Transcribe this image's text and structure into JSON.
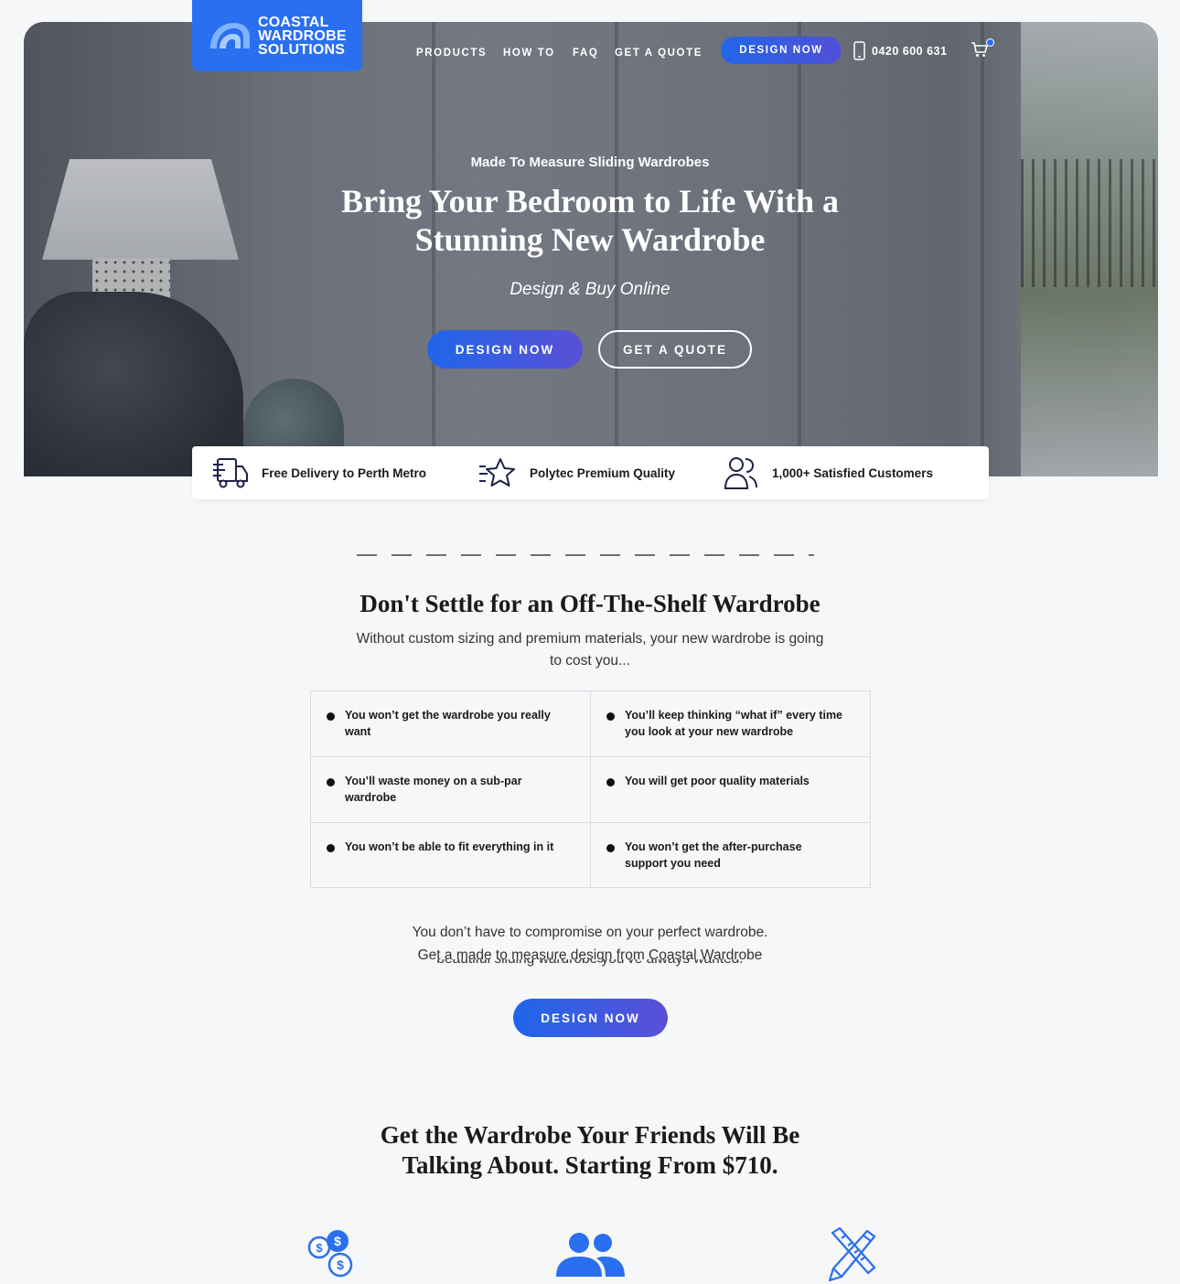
{
  "brand": {
    "line1": "COASTAL",
    "line2": "WARDROBE",
    "line3": "SOLUTIONS",
    "color": "#2a6ff0"
  },
  "nav": {
    "links": [
      "PRODUCTS",
      "HOW TO",
      "FAQ",
      "GET A QUOTE"
    ],
    "design_button": "DESIGN NOW",
    "phone": "0420 600 631",
    "cart_icon": "cart-icon",
    "phone_icon": "phone-icon"
  },
  "hero": {
    "eyebrow": "Made To Measure Sliding Wardrobes",
    "title": "Bring Your Bedroom to Life With a Stunning New Wardrobe",
    "subtitle": "Design & Buy Online",
    "primary_button": "DESIGN NOW",
    "secondary_button": "GET A QUOTE"
  },
  "features": [
    {
      "icon": "delivery-truck-icon",
      "label": "Free Delivery to Perth Metro"
    },
    {
      "icon": "star-icon",
      "label": "Polytec Premium Quality"
    },
    {
      "icon": "customers-icon",
      "label": "1,000+ Satisfied Customers"
    }
  ],
  "problems": {
    "title": "Don't Settle for an Off-The-Shelf Wardrobe",
    "subtitle": "Without custom sizing and premium materials, your new wardrobe is going to cost you...",
    "items": [
      "You won’t get the wardrobe you really want",
      "You’ll keep thinking “what if” every time you look at your new wardrobe",
      "You’ll waste money on a sub-par wardrobe",
      "You will get poor quality materials",
      "You won’t be able to fit everything in it",
      "You won’t get the after-purchase support you need"
    ],
    "closing_line1": "You don’t have to compromise on your perfect wardrobe.",
    "closing_line2": "Get a made to measure design from Coastal Wardrobe",
    "closing_line3": "beautiful sliding wardrobe you’ve always wanted.",
    "button": "DESIGN NOW"
  },
  "pricing": {
    "title": "Get the Wardrobe Your Friends Will Be Talking About. Starting From $710.",
    "icons": [
      "dollar-coins-icon",
      "people-icon",
      "pencil-ruler-icon"
    ]
  },
  "colors": {
    "accent": "#2a6ff0",
    "gradient_end": "#5a50d6",
    "background": "#f6f7f9",
    "icon_navy": "#1c2147"
  }
}
